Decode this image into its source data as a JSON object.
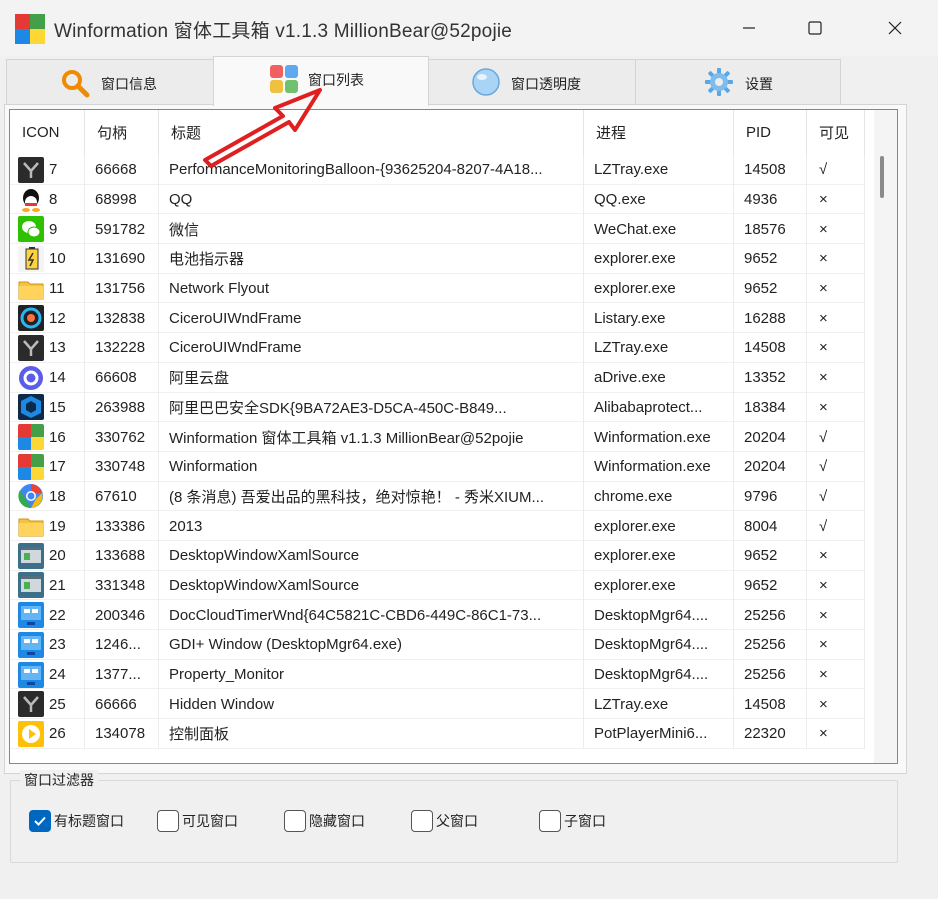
{
  "window": {
    "title": "Winformation 窗体工具箱 v1.1.3  MillionBear@52pojie",
    "controls": [
      "minimize-icon",
      "maximize-icon",
      "close-icon"
    ]
  },
  "tabs": [
    {
      "label": "窗口信息",
      "icon": "search-icon",
      "active": false
    },
    {
      "label": "窗口列表",
      "icon": "window-list-icon",
      "active": true
    },
    {
      "label": "窗口透明度",
      "icon": "transparency-icon",
      "active": false
    },
    {
      "label": "设置",
      "icon": "gear-icon",
      "active": false
    }
  ],
  "table": {
    "columns": [
      "ICON",
      "句柄",
      "标题",
      "进程",
      "PID",
      "可见"
    ],
    "rows": [
      {
        "icon": "lztray-icon",
        "idx": "7",
        "handle": "66668",
        "title": "PerformanceMonitoringBalloon-{93625204-8207-4A18...",
        "process": "LZTray.exe",
        "pid": "14508",
        "visible": "√"
      },
      {
        "icon": "qq-icon",
        "idx": "8",
        "handle": "68998",
        "title": "QQ",
        "process": "QQ.exe",
        "pid": "4936",
        "visible": "×"
      },
      {
        "icon": "wechat-icon",
        "idx": "9",
        "handle": "591782",
        "title": "微信",
        "process": "WeChat.exe",
        "pid": "18576",
        "visible": "×"
      },
      {
        "icon": "battery-icon",
        "idx": "10",
        "handle": "131690",
        "title": "电池指示器",
        "process": "explorer.exe",
        "pid": "9652",
        "visible": "×"
      },
      {
        "icon": "folder-icon",
        "idx": "11",
        "handle": "131756",
        "title": "Network Flyout",
        "process": "explorer.exe",
        "pid": "9652",
        "visible": "×"
      },
      {
        "icon": "listary-icon",
        "idx": "12",
        "handle": "132838",
        "title": "CiceroUIWndFrame",
        "process": "Listary.exe",
        "pid": "16288",
        "visible": "×"
      },
      {
        "icon": "lztray-icon",
        "idx": "13",
        "handle": "132228",
        "title": "CiceroUIWndFrame",
        "process": "LZTray.exe",
        "pid": "14508",
        "visible": "×"
      },
      {
        "icon": "adrive-icon",
        "idx": "14",
        "handle": "66608",
        "title": "阿里云盘",
        "process": "aDrive.exe",
        "pid": "13352",
        "visible": "×"
      },
      {
        "icon": "shield-icon",
        "idx": "15",
        "handle": "263988",
        "title": "阿里巴巴安全SDK{9BA72AE3-D5CA-450C-B849...",
        "process": "Alibabaprotect...",
        "pid": "18384",
        "visible": "×"
      },
      {
        "icon": "winformation-icon",
        "idx": "16",
        "handle": "330762",
        "title": "Winformation 窗体工具箱 v1.1.3  MillionBear@52pojie",
        "process": "Winformation.exe",
        "pid": "20204",
        "visible": "√"
      },
      {
        "icon": "winformation-icon",
        "idx": "17",
        "handle": "330748",
        "title": "Winformation",
        "process": "Winformation.exe",
        "pid": "20204",
        "visible": "√"
      },
      {
        "icon": "chrome-icon",
        "idx": "18",
        "handle": "67610",
        "title": "(8 条消息) 吾爱出品的黑科技，绝对惊艳！ - 秀米XIUM...",
        "process": "chrome.exe",
        "pid": "9796",
        "visible": "√"
      },
      {
        "icon": "folder-icon",
        "idx": "19",
        "handle": "133386",
        "title": "2013",
        "process": "explorer.exe",
        "pid": "8004",
        "visible": "√"
      },
      {
        "icon": "xaml-icon",
        "idx": "20",
        "handle": "133688",
        "title": "DesktopWindowXamlSource",
        "process": "explorer.exe",
        "pid": "9652",
        "visible": "×"
      },
      {
        "icon": "xaml-icon",
        "idx": "21",
        "handle": "331348",
        "title": "DesktopWindowXamlSource",
        "process": "explorer.exe",
        "pid": "9652",
        "visible": "×"
      },
      {
        "icon": "desktop-mgr-icon",
        "idx": "22",
        "handle": "200346",
        "title": "DocCloudTimerWnd{64C5821C-CBD6-449C-86C1-73...",
        "process": "DesktopMgr64....",
        "pid": "25256",
        "visible": "×"
      },
      {
        "icon": "desktop-mgr-icon",
        "idx": "23",
        "handle": "1246...",
        "title": "GDI+ Window (DesktopMgr64.exe)",
        "process": "DesktopMgr64....",
        "pid": "25256",
        "visible": "×"
      },
      {
        "icon": "desktop-mgr-icon",
        "idx": "24",
        "handle": "1377...",
        "title": "Property_Monitor",
        "process": "DesktopMgr64....",
        "pid": "25256",
        "visible": "×"
      },
      {
        "icon": "lztray-icon",
        "idx": "25",
        "handle": "66666",
        "title": "Hidden Window",
        "process": "LZTray.exe",
        "pid": "14508",
        "visible": "×"
      },
      {
        "icon": "potplayer-icon",
        "idx": "26",
        "handle": "134078",
        "title": "控制面板",
        "process": "PotPlayerMini6...",
        "pid": "22320",
        "visible": "×"
      }
    ]
  },
  "filter": {
    "legend": "窗口过滤器",
    "options": [
      {
        "label": "有标题窗口",
        "checked": true
      },
      {
        "label": "可见窗口",
        "checked": false
      },
      {
        "label": "隐藏窗口",
        "checked": false
      },
      {
        "label": "父窗口",
        "checked": false
      },
      {
        "label": "子窗口",
        "checked": false
      }
    ]
  },
  "colors": {
    "accent": "#0067c0",
    "annotation_arrow": "#e02020"
  }
}
